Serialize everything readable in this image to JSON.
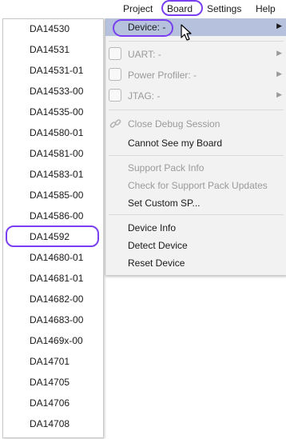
{
  "menubar": {
    "items": [
      {
        "label": "Project"
      },
      {
        "label": "Board"
      },
      {
        "label": "Settings"
      },
      {
        "label": "Help"
      }
    ]
  },
  "board_menu": {
    "device": {
      "label": "Device: -"
    },
    "uart": {
      "label": "UART: -"
    },
    "power_profiler": {
      "label": "Power Profiler: -"
    },
    "jtag": {
      "label": "JTAG: -"
    },
    "close_debug": {
      "label": "Close Debug Session"
    },
    "cannot_see": {
      "label": "Cannot See my Board"
    },
    "support_pack_info": {
      "label": "Support Pack Info"
    },
    "check_updates": {
      "label": "Check for Support Pack Updates"
    },
    "set_custom": {
      "label": "Set Custom SP..."
    },
    "device_info": {
      "label": "Device Info"
    },
    "detect_device": {
      "label": "Detect Device"
    },
    "reset_device": {
      "label": "Reset Device"
    }
  },
  "device_list": {
    "items": [
      "DA14530",
      "DA14531",
      "DA14531-01",
      "DA14533-00",
      "DA14535-00",
      "DA14580-01",
      "DA14581-00",
      "DA14583-01",
      "DA14585-00",
      "DA14586-00",
      "DA14592",
      "DA14680-01",
      "DA14681-01",
      "DA14682-00",
      "DA14683-00",
      "DA1469x-00",
      "DA14701",
      "DA14705",
      "DA14706",
      "DA14708"
    ],
    "highlighted": "DA14592"
  },
  "colors": {
    "annotation": "#7a3ff0",
    "highlight": "#b6c2dd",
    "disabled_text": "#9a9a9a"
  }
}
